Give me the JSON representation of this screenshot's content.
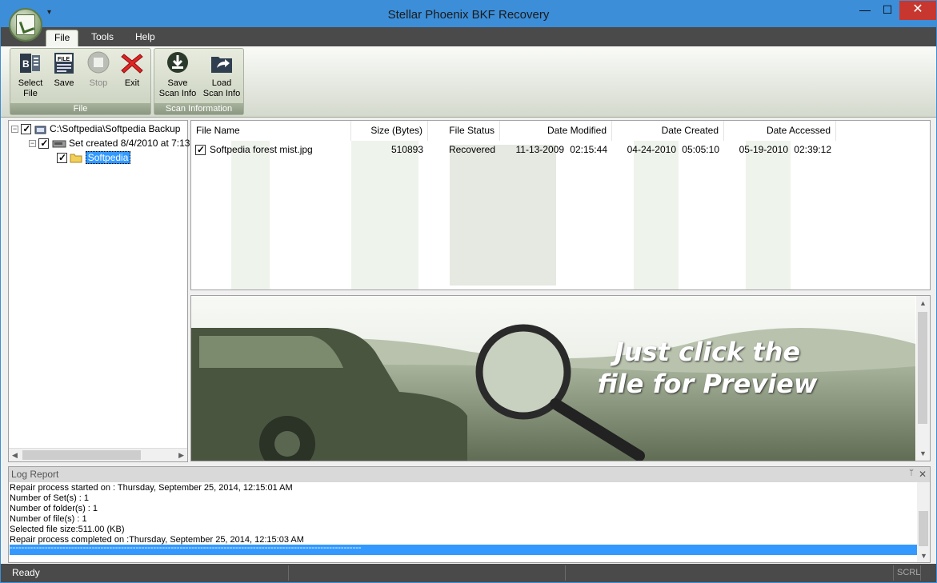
{
  "window": {
    "title": "Stellar Phoenix BKF Recovery",
    "controls": {
      "minimize": "—",
      "maximize": "☐",
      "close": "✕"
    },
    "qat_glyph": "▾"
  },
  "tabs": [
    {
      "label": "File",
      "active": true
    },
    {
      "label": "Tools",
      "active": false
    },
    {
      "label": "Help",
      "active": false
    }
  ],
  "ribbon": {
    "file_group": {
      "label": "File",
      "buttons": [
        {
          "label_line1": "Select",
          "label_line2": "File",
          "icon": "select-file-icon"
        },
        {
          "label_line1": "Save",
          "label_line2": "",
          "icon": "save-icon"
        },
        {
          "label_line1": "Stop",
          "label_line2": "",
          "icon": "stop-icon",
          "disabled": true
        },
        {
          "label_line1": "Exit",
          "label_line2": "",
          "icon": "exit-icon"
        }
      ]
    },
    "scan_group": {
      "label": "Scan Information",
      "buttons": [
        {
          "label_line1": "Save",
          "label_line2": "Scan Info",
          "icon": "save-scan-info-icon"
        },
        {
          "label_line1": "Load",
          "label_line2": "Scan Info",
          "icon": "load-scan-info-icon"
        }
      ]
    }
  },
  "tree": {
    "items": [
      {
        "label": "C:\\Softpedia\\Softpedia Backup",
        "expander": "−",
        "icon": "backup-file-icon"
      },
      {
        "label": "Set created 8/4/2010 at 7:13",
        "expander": "−",
        "icon": "tape-drive-icon"
      },
      {
        "label": "Softpedia",
        "icon": "folder-icon",
        "selected": true
      }
    ]
  },
  "file_table": {
    "columns": [
      "File Name",
      "Size (Bytes)",
      "File Status",
      "Date Modified",
      "Date Created",
      "Date Accessed"
    ],
    "rows": [
      {
        "name": "Softpedia forest mist.jpg",
        "size": "510893",
        "status": "Recovered",
        "modified_date": "11-13-2009",
        "modified_time": "02:15:44",
        "created_date": "04-24-2010",
        "created_time": "05:05:10",
        "accessed_date": "05-19-2010",
        "accessed_time": "02:39:12",
        "checked": true
      }
    ]
  },
  "preview": {
    "line1": "Just click the",
    "line2": "file for Preview"
  },
  "log": {
    "title": "Log Report",
    "pin": "📌",
    "close": "✕",
    "lines": [
      "Repair process started on : Thursday, September 25, 2014, 12:15:01 AM",
      "Number of Set(s) : 1",
      "Number of folder(s) : 1",
      "Number of file(s) : 1",
      "Selected file size:511.00 (KB)",
      "Repair process completed on :Thursday, September 25, 2014, 12:15:03 AM"
    ],
    "separator": "------------------------------------------------------------------------------------------------------------------------"
  },
  "status": {
    "text": "Ready",
    "scrl": "SCRL"
  },
  "colors": {
    "title_bar": "#3c8ed8",
    "dark_bar": "#4a4a4a",
    "selection": "#3399ff",
    "close_red": "#c7372f"
  }
}
